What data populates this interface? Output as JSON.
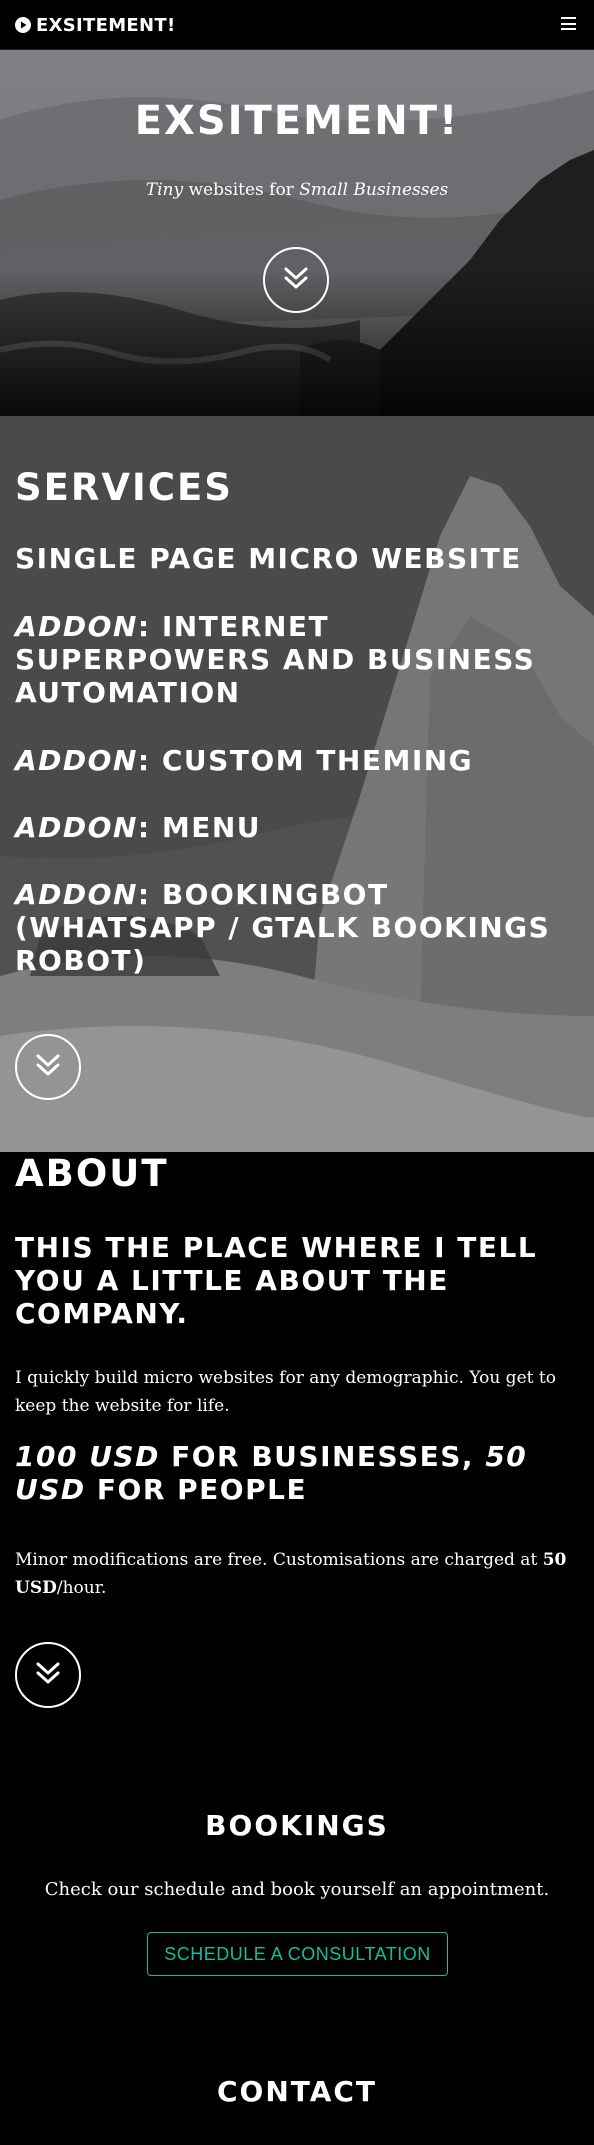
{
  "navbar": {
    "brand": "EXSITEMENT!",
    "brand_icon": "play-circle-icon",
    "menu_icon": "hamburger-menu-icon"
  },
  "hero": {
    "title": "EXSITEMENT!",
    "subtitle_part1": "Tiny",
    "subtitle_part2": " websites for ",
    "subtitle_part3": "Small Businesses",
    "scroll_icon": "double-chevron-down-icon"
  },
  "services": {
    "heading": "SERVICES",
    "items": [
      {
        "prefix": "",
        "text": "Single page micro website"
      },
      {
        "prefix": "Addon",
        "text": ": Internet superpowers and Business automation"
      },
      {
        "prefix": "Addon",
        "text": ": Custom Theming"
      },
      {
        "prefix": "Addon",
        "text": ": Menu"
      },
      {
        "prefix": "Addon",
        "text": ": BookingBot (WhatsApp / GTalk bookings robot)"
      }
    ],
    "scroll_icon": "double-chevron-down-icon"
  },
  "about": {
    "heading": "ABOUT",
    "tagline": "This the place where I tell you a little about the company.",
    "paragraph1": "I quickly build micro websites for any demographic. You get to keep the website for life.",
    "price_business": "100 USD",
    "price_mid": " for businesses, ",
    "price_people": "50 USD",
    "price_end": " for people",
    "paragraph2_start": "Minor modifications are free. Customisations are charged at ",
    "paragraph2_rate": "50 USD",
    "paragraph2_end": "/hour.",
    "scroll_icon": "double-chevron-down-icon"
  },
  "bookings": {
    "heading": "BOOKINGS",
    "text": "Check our schedule and book yourself an appointment.",
    "button_label": "Schedule a consultation"
  },
  "contact": {
    "heading": "CONTACT"
  },
  "colors": {
    "accent": "#18bc9c",
    "background": "#000000",
    "text": "#ffffff"
  }
}
